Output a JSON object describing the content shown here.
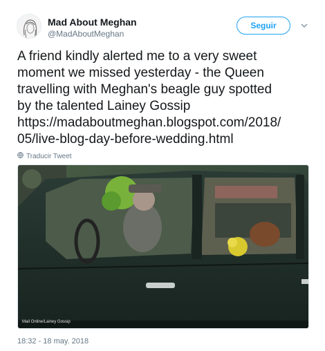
{
  "user": {
    "display_name": "Mad About Meghan",
    "handle": "@MadAboutMeghan",
    "avatar_icon": "avatar-sketch-icon"
  },
  "follow_button": {
    "label": "Seguir",
    "color": "#1da1f2"
  },
  "menu_icon": "chevron-down-icon",
  "tweet": {
    "text": "A friend kindly alerted me to a very sweet\nmoment we missed yesterday - the Queen\ntravelling with Meghan's beagle guy spotted\nby the talented Lainey Gossip\nhttps://madaboutmeghan.blogspot.com/2018/\n05/live-blog-day-before-wedding.html"
  },
  "translate": {
    "icon": "globe-icon",
    "label": "Traducir Tweet"
  },
  "media": {
    "caption": "Mail Online/Lainey Gossip"
  },
  "timestamp": "18:32 - 18 may. 2018",
  "colors": {
    "text": "#14171a",
    "secondary": "#657786",
    "accent": "#1da1f2"
  }
}
